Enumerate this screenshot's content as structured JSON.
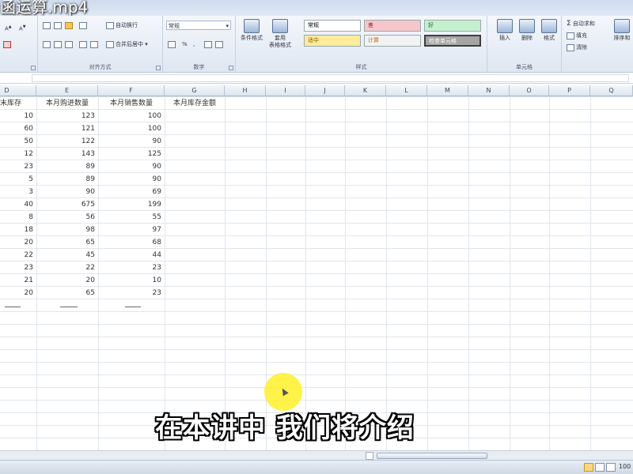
{
  "video_title": "函运算.mp4",
  "ribbon": {
    "groups": {
      "alignment": "对齐方式",
      "number": "数字",
      "styles": "样式",
      "cells": "单元格"
    },
    "font_buttons": [
      "A",
      "A"
    ],
    "wrap_text": "自动换行",
    "merge_center": "合并后居中",
    "number_format": "常规",
    "number_symbols": [
      "%",
      ","
    ],
    "conditional_format": "条件格式",
    "format_as_table": [
      "套用",
      "表格格式"
    ],
    "styles": {
      "normal": "常规",
      "bad": "差",
      "good": "好",
      "neutral": "适中",
      "calculation": "计算",
      "check_cell": "检查单元格"
    },
    "insert": "插入",
    "delete": "删除",
    "format": "格式",
    "autosum": "自动求和",
    "fill": "填充",
    "clear": "清除",
    "sort_filter": "排序和"
  },
  "columns": [
    "D",
    "E",
    "F",
    "G",
    "H",
    "I",
    "J",
    "K",
    "L",
    "M",
    "N",
    "O",
    "P",
    "Q"
  ],
  "table": {
    "headers": [
      "月末库存",
      "本月购进数量",
      "本月销售数量",
      "本月库存金额"
    ],
    "rows": [
      [
        "10",
        "123",
        "100"
      ],
      [
        "60",
        "121",
        "100"
      ],
      [
        "50",
        "122",
        "90"
      ],
      [
        "12",
        "143",
        "125"
      ],
      [
        "23",
        "89",
        "90"
      ],
      [
        "5",
        "89",
        "90"
      ],
      [
        "3",
        "90",
        "69"
      ],
      [
        "40",
        "675",
        "199"
      ],
      [
        "8",
        "56",
        "55"
      ],
      [
        "18",
        "98",
        "97"
      ],
      [
        "20",
        "65",
        "68"
      ],
      [
        "22",
        "45",
        "44"
      ],
      [
        "23",
        "22",
        "23"
      ],
      [
        "21",
        "20",
        "10"
      ],
      [
        "20",
        "65",
        "23"
      ]
    ]
  },
  "subtitle": "在本讲中 我们将介绍",
  "status": {
    "zoom": "100"
  }
}
